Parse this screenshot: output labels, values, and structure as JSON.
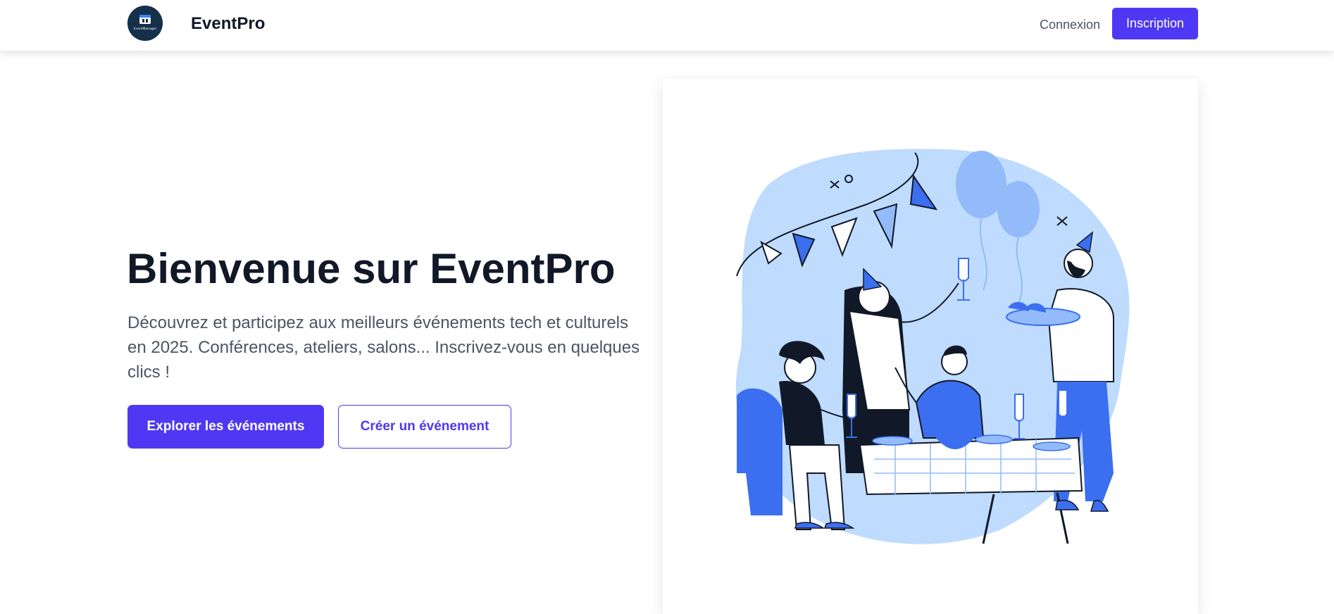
{
  "header": {
    "logo_text": "EventManager",
    "brand": "EventPro",
    "login_label": "Connexion",
    "signup_label": "Inscription"
  },
  "hero": {
    "title": "Bienvenue sur EventPro",
    "description": "Découvrez et participez aux meilleurs événements tech et culturels en 2025. Conférences, ateliers, salons... Inscrivez-vous en quelques clics !",
    "primary_button": "Explorer les événements",
    "secondary_button": "Créer un événement"
  },
  "illustration": {
    "icon": "party-illustration"
  },
  "colors": {
    "accent": "#4f38f4",
    "heading": "#111827",
    "body_text": "#4b5563",
    "logo_bg": "#15304a",
    "illustration_light": "#bfdbfe",
    "illustration_mid": "#93bbf9",
    "illustration_dark": "#3b6ff0"
  }
}
